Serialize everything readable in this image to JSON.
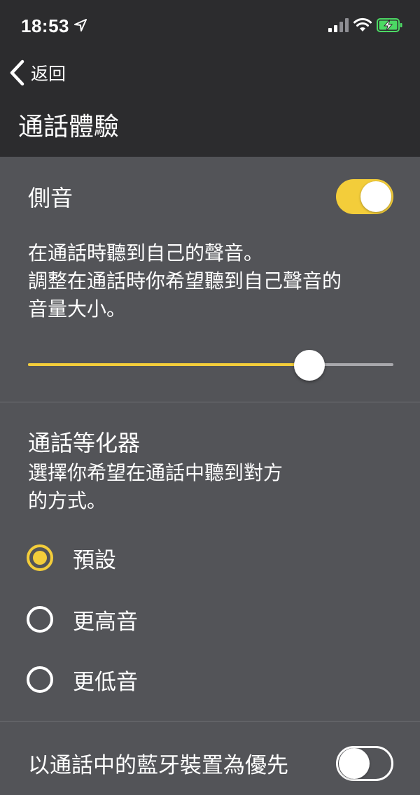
{
  "status_bar": {
    "time": "18:53",
    "location_icon": "location-arrow-icon",
    "signal_icon": "cellular-signal-icon",
    "wifi_icon": "wifi-icon",
    "battery_icon": "battery-charging-icon",
    "battery_color": "#4cd964"
  },
  "nav": {
    "back_label": "返回",
    "back_icon": "chevron-left-icon",
    "title": "通話體驗"
  },
  "sidetone": {
    "title": "側音",
    "enabled": true,
    "description_line1": "在通話時聽到自己的聲音。",
    "description_line2": "調整在通話時你希望聽到自己聲音的",
    "description_line3": "音量大小。",
    "volume_fraction": 0.77
  },
  "equalizer": {
    "title": "通話等化器",
    "description_line1": "選擇你希望在通話中聽到對方",
    "description_line2": "的方式。",
    "options": [
      {
        "label": "預設",
        "selected": true
      },
      {
        "label": "更高音",
        "selected": false
      },
      {
        "label": "更低音",
        "selected": false
      }
    ]
  },
  "bluetooth_priority": {
    "title": "以通話中的藍牙裝置為優先",
    "enabled": false
  },
  "colors": {
    "accent": "#f3cd3a",
    "header_bg": "#2c2c2e",
    "content_bg": "#535458"
  }
}
